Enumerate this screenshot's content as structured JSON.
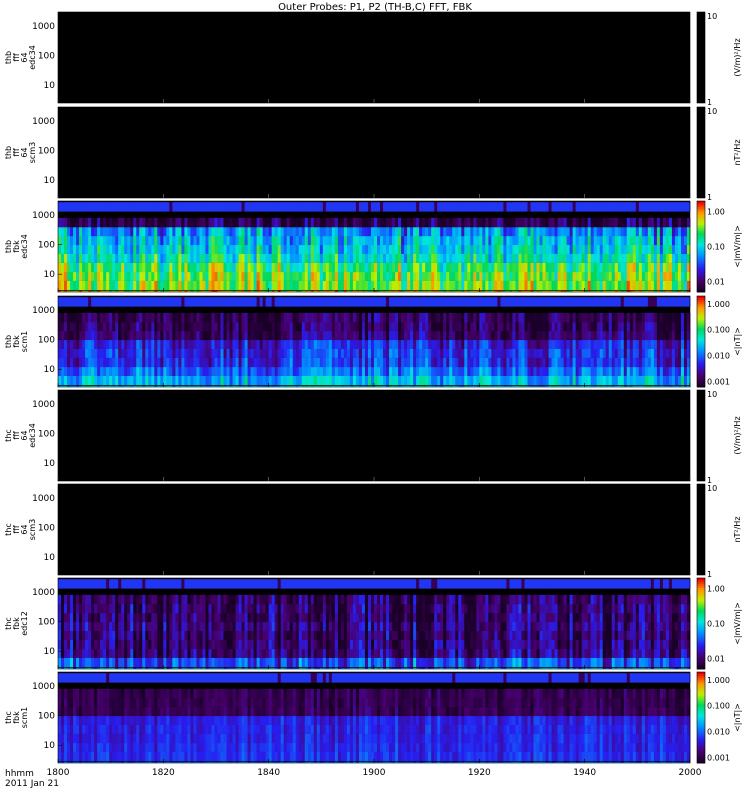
{
  "title": "Outer Probes: P1, P2 (TH-B,C) FFT, FBK",
  "time_axis": {
    "label_line1": "hhmm",
    "label_line2": "2011 Jan 21",
    "ticks": [
      "1800",
      "1820",
      "1840",
      "1900",
      "1920",
      "1940",
      "2000"
    ]
  },
  "chart_data": [
    {
      "type": "heatmap",
      "panel_label": [
        "thb",
        "fff",
        "64",
        "edc34"
      ],
      "unit_label": "(V/m)²/Hz",
      "freq_ticks": [
        "10",
        "100",
        "1000"
      ],
      "colorbar_ticks": [
        "1",
        "10"
      ],
      "colorbar_range": [
        1,
        10
      ],
      "colormap": "rainbow",
      "content": "no data (black)"
    },
    {
      "type": "heatmap",
      "panel_label": [
        "thb",
        "fff",
        "64",
        "scm3"
      ],
      "unit_label": "nT²/Hz",
      "freq_ticks": [
        "10",
        "100",
        "1000"
      ],
      "colorbar_ticks": [
        "1",
        "10"
      ],
      "colorbar_range": [
        1,
        10
      ],
      "colormap": "rainbow",
      "content": "no data (black)"
    },
    {
      "type": "heatmap",
      "panel_label": [
        "thb",
        "fbk",
        "edc34"
      ],
      "unit_label": "<|mV/m|>",
      "freq_ticks": [
        "10",
        "100",
        "1000"
      ],
      "colorbar_ticks": [
        "1.00",
        "0.10",
        "0.01"
      ],
      "colorbar_range": [
        0.005,
        2.0
      ],
      "colormap": "rainbow",
      "content": "spectrogram"
    },
    {
      "type": "heatmap",
      "panel_label": [
        "thb",
        "fbk",
        "scm1"
      ],
      "unit_label": "<|nT|>",
      "freq_ticks": [
        "10",
        "100",
        "1000"
      ],
      "colorbar_ticks": [
        "1.000",
        "0.100",
        "0.010",
        "0.001"
      ],
      "colorbar_range": [
        0.0006,
        2.0
      ],
      "colormap": "rainbow",
      "content": "spectrogram"
    },
    {
      "type": "heatmap",
      "panel_label": [
        "thc",
        "fff",
        "64",
        "edc34"
      ],
      "unit_label": "(V/m)²/Hz",
      "freq_ticks": [
        "10",
        "100",
        "1000"
      ],
      "colorbar_ticks": [
        "1",
        "10"
      ],
      "colorbar_range": [
        1,
        10
      ],
      "colormap": "rainbow",
      "content": "no data (black)"
    },
    {
      "type": "heatmap",
      "panel_label": [
        "thc",
        "fff",
        "64",
        "scm3"
      ],
      "unit_label": "nT²/Hz",
      "freq_ticks": [
        "10",
        "100",
        "1000"
      ],
      "colorbar_ticks": [
        "1",
        "10"
      ],
      "colorbar_range": [
        1,
        10
      ],
      "colormap": "rainbow",
      "content": "no data (black)"
    },
    {
      "type": "heatmap",
      "panel_label": [
        "thc",
        "fbk",
        "edc12"
      ],
      "unit_label": "<|mV/m|>",
      "freq_ticks": [
        "10",
        "100",
        "1000"
      ],
      "colorbar_ticks": [
        "1.00",
        "0.10",
        "0.01"
      ],
      "colorbar_range": [
        0.005,
        2.0
      ],
      "colormap": "rainbow",
      "content": "spectrogram"
    },
    {
      "type": "heatmap",
      "panel_label": [
        "thc",
        "fbk",
        "scm1"
      ],
      "unit_label": "<|nT|>",
      "freq_ticks": [
        "10",
        "100",
        "1000"
      ],
      "colorbar_ticks": [
        "1.000",
        "0.100",
        "0.010",
        "0.001"
      ],
      "colorbar_range": [
        0.0006,
        2.0
      ],
      "colormap": "rainbow",
      "content": "spectrogram"
    }
  ]
}
